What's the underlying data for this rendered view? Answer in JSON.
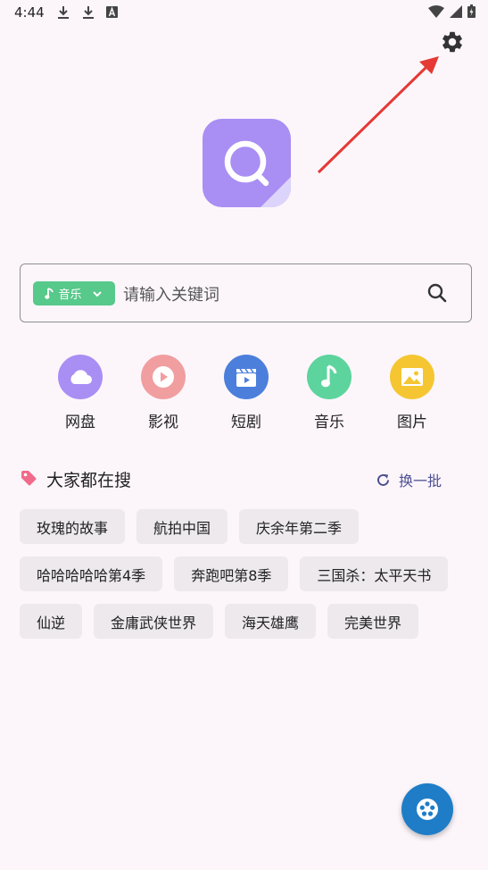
{
  "status": {
    "time": "4:44"
  },
  "search": {
    "category": "音乐",
    "placeholder": "请输入关键词"
  },
  "quick": [
    {
      "label": "网盘",
      "color": "#a98ef4"
    },
    {
      "label": "影视",
      "color": "#f19ea0"
    },
    {
      "label": "短剧",
      "color": "#4b7fdb"
    },
    {
      "label": "音乐",
      "color": "#5dd49d"
    },
    {
      "label": "图片",
      "color": "#f5c632"
    }
  ],
  "hot": {
    "title": "大家都在搜",
    "refresh": "换一批",
    "tags": [
      "玫瑰的故事",
      "航拍中国",
      "庆余年第二季",
      "哈哈哈哈哈第4季",
      "奔跑吧第8季",
      "三国杀：太平天书",
      "仙逆",
      "金庸武侠世界",
      "海天雄鹰",
      "完美世界"
    ]
  },
  "colors": {
    "accent": "#1f7dc7",
    "arrow": "#e53935",
    "background": "#fcf6fb"
  }
}
